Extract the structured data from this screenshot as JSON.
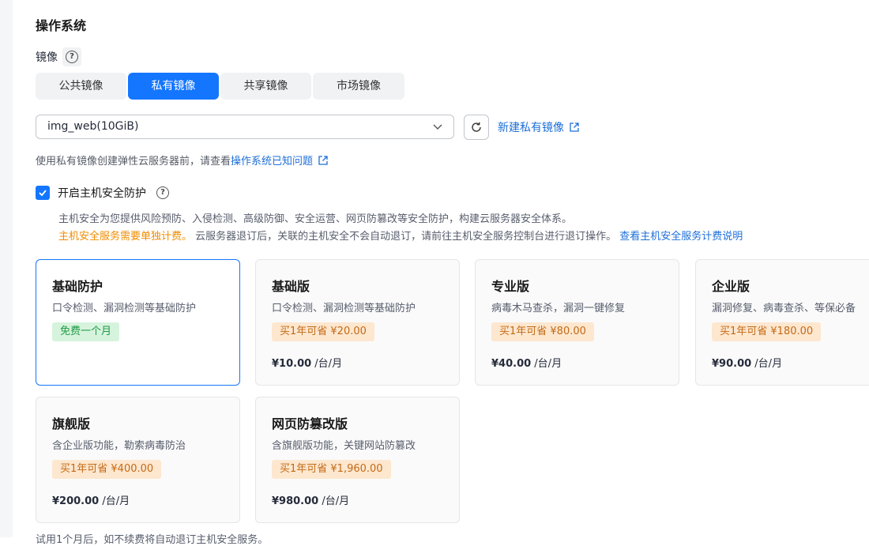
{
  "section_title": "操作系统",
  "image_label": "镜像",
  "tabs": [
    {
      "label": "公共镜像",
      "active": false
    },
    {
      "label": "私有镜像",
      "active": true
    },
    {
      "label": "共享镜像",
      "active": false
    },
    {
      "label": "市场镜像",
      "active": false
    }
  ],
  "image_select": {
    "value": "img_web(10GiB)"
  },
  "new_image_link": "新建私有镜像",
  "tip": {
    "text": "使用私有镜像创建弹性云服务器前，请查看",
    "link": "操作系统已知问题"
  },
  "host_security": {
    "checked": true,
    "label": "开启主机安全防护",
    "desc1": "主机安全为您提供风险预防、入侵检测、高级防御、安全运营、网页防篡改等安全防护，构建云服务器安全体系。",
    "warn": "主机安全服务需要单独计费。",
    "desc2": " 云服务器退订后，关联的主机安全不会自动退订，请前往主机安全服务控制台进行退订操作。",
    "link": "查看主机安全服务计费说明"
  },
  "plans": [
    {
      "name": "基础防护",
      "desc": "口令检测、漏洞检测等基础防护",
      "badge": "免费一个月",
      "badge_type": "green",
      "price": "",
      "unit": "",
      "selected": true
    },
    {
      "name": "基础版",
      "desc": "口令检测、漏洞检测等基础防护",
      "badge": "买1年可省 ¥20.00",
      "badge_type": "orange",
      "price": "¥10.00",
      "unit": " /台/月",
      "selected": false
    },
    {
      "name": "专业版",
      "desc": "病毒木马查杀，漏洞一键修复",
      "badge": "买1年可省 ¥80.00",
      "badge_type": "orange",
      "price": "¥40.00",
      "unit": " /台/月",
      "selected": false
    },
    {
      "name": "企业版",
      "desc": "漏洞修复、病毒查杀、等保必备",
      "badge": "买1年可省 ¥180.00",
      "badge_type": "orange",
      "price": "¥90.00",
      "unit": " /台/月",
      "selected": false
    },
    {
      "name": "旗舰版",
      "desc": "含企业版功能，勒索病毒防治",
      "badge": "买1年可省 ¥400.00",
      "badge_type": "orange",
      "price": "¥200.00",
      "unit": " /台/月",
      "selected": false
    },
    {
      "name": "网页防篡改版",
      "desc": "含旗舰版功能，关键网站防篡改",
      "badge": "买1年可省 ¥1,960.00",
      "badge_type": "orange",
      "price": "¥980.00",
      "unit": " /台/月",
      "selected": false
    }
  ],
  "bottom_text": "试用1个月后，如不续费将自动退订主机安全服务。"
}
